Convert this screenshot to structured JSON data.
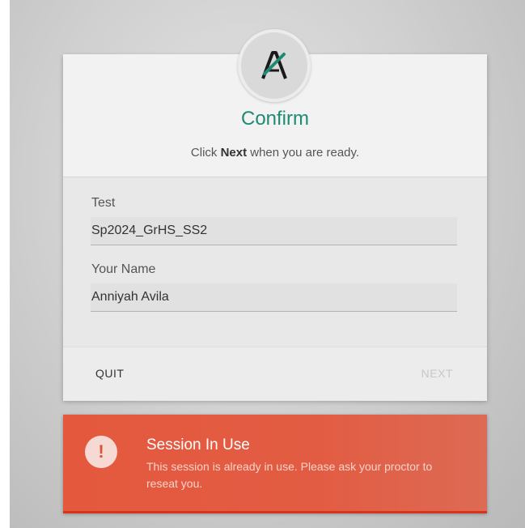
{
  "dialog": {
    "logo_icon": "ayr-logo-icon",
    "title": "Confirm",
    "subtitle_prefix": "Click ",
    "subtitle_bold": "Next",
    "subtitle_suffix": " when you are ready.",
    "fields": [
      {
        "label": "Test",
        "value": "Sp2024_GrHS_SS2"
      },
      {
        "label": "Your Name",
        "value": "Anniyah Avila"
      }
    ],
    "quit_label": "QUIT",
    "next_label": "NEXT",
    "next_enabled": false
  },
  "alert": {
    "icon": "exclamation-icon",
    "icon_glyph": "!",
    "title": "Session In Use",
    "message": "This session is already in use. Please ask your proctor to reseat you."
  },
  "colors": {
    "accent": "#1e8a74",
    "alert_background": "#e4593e",
    "alert_border": "#d9321d"
  }
}
